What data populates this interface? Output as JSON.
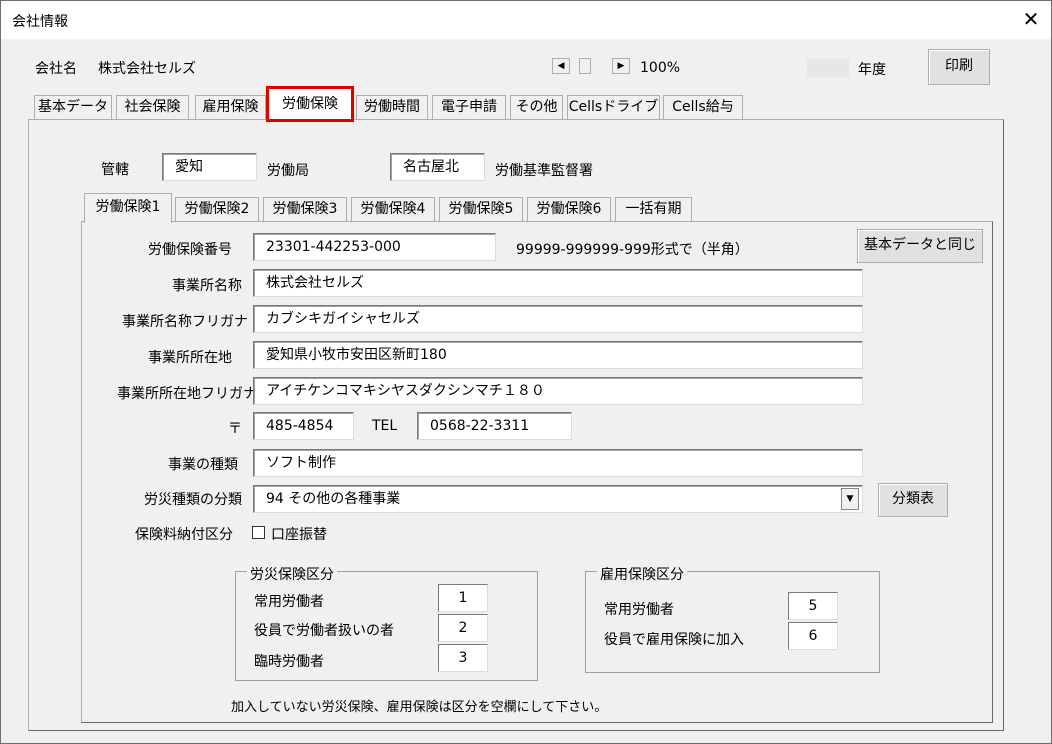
{
  "window": {
    "title": "会社情報",
    "close": "✕"
  },
  "header": {
    "company_label": "会社名",
    "company_name": "株式会社セルズ",
    "zoom": "100%",
    "year_label": "年度",
    "print_button": "印刷"
  },
  "main_tabs": [
    "基本データ",
    "社会保険",
    "雇用保険",
    "労働保険",
    "労働時間",
    "電子申請",
    "その他",
    "Cellsドライブ",
    "Cells給与"
  ],
  "jurisdiction": {
    "label": "管轄",
    "prefecture": "愛知",
    "bureau_label": "労働局",
    "office": "名古屋北",
    "office_label": "労働基準監督署"
  },
  "sub_tabs": [
    "労働保険1",
    "労働保険2",
    "労働保険3",
    "労働保険4",
    "労働保険5",
    "労働保険6",
    "一括有期"
  ],
  "form": {
    "insurance_no_label": "労働保険番号",
    "insurance_no": "23301-442253-000",
    "insurance_no_hint": "99999-999999-999形式で（半角）",
    "same_as_basic_button": "基本データと同じ",
    "office_name_label": "事業所名称",
    "office_name": "株式会社セルズ",
    "office_kana_label": "事業所名称フリガナ",
    "office_kana": "カブシキガイシャセルズ",
    "address_label": "事業所所在地",
    "address": "愛知県小牧市安田区新町180",
    "address_kana_label": "事業所所在地フリガナ",
    "address_kana": "アイチケンコマキシヤスダクシンマチ１８０",
    "zip_label": "〒",
    "zip": "485-4854",
    "tel_label": "TEL",
    "tel": "0568-22-3311",
    "business_type_label": "事業の種類",
    "business_type": "ソフト制作",
    "accident_class_label": "労災種類の分類",
    "accident_class": "94 その他の各種事業",
    "class_table_button": "分類表",
    "payment_label": "保険料納付区分",
    "payment_checkbox": "口座振替"
  },
  "accident_group": {
    "title": "労災保険区分",
    "rows": [
      {
        "label": "常用労働者",
        "value": "1"
      },
      {
        "label": "役員で労働者扱いの者",
        "value": "2"
      },
      {
        "label": "臨時労働者",
        "value": "3"
      }
    ]
  },
  "employment_group": {
    "title": "雇用保険区分",
    "rows": [
      {
        "label": "常用労働者",
        "value": "5"
      },
      {
        "label": "役員で雇用保険に加入",
        "value": "6"
      }
    ]
  },
  "footer_note": "加入していない労災保険、雇用保険は区分を空欄にして下さい。"
}
